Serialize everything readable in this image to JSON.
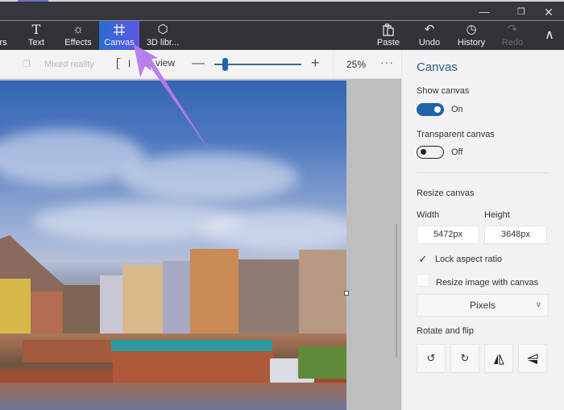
{
  "window": {
    "controls": {
      "minimize": "—",
      "restore": "❐",
      "close": "✕"
    }
  },
  "ribbon": {
    "left_items": [
      {
        "label": "ers",
        "icon": "stickers-icon"
      },
      {
        "label": "Text",
        "icon": "text-icon",
        "glyph": "T"
      },
      {
        "label": "Effects",
        "icon": "effects-icon",
        "glyph": "☼"
      },
      {
        "label": "Canvas",
        "icon": "canvas-icon",
        "glyph": "⌗",
        "active": true
      },
      {
        "label": "3D libr...",
        "icon": "3d-library-icon",
        "glyph": "⬡"
      }
    ],
    "right_items": [
      {
        "label": "Paste",
        "icon": "paste-icon",
        "glyph": "📋"
      },
      {
        "label": "Undo",
        "icon": "undo-icon",
        "glyph": "↶"
      },
      {
        "label": "History",
        "icon": "history-icon",
        "glyph": "◷"
      },
      {
        "label": "Redo",
        "icon": "redo-icon",
        "glyph": "↷",
        "disabled": true
      }
    ],
    "collapse_glyph": "∧",
    "active_color": "#2d6bd1"
  },
  "toolbar": {
    "mixed_reality": "Mixed reality",
    "mixed_reality_glyph": "❐",
    "view_3d": "3D view",
    "zoom_minus": "—",
    "zoom_plus": "+",
    "zoom_value": "25%",
    "zoom_fraction": 0.1,
    "more": "···"
  },
  "panel": {
    "title": "Canvas",
    "show_canvas": {
      "label": "Show canvas",
      "state": "On",
      "on": true
    },
    "transparent_canvas": {
      "label": "Transparent canvas",
      "state": "Off",
      "on": false
    },
    "resize_canvas": "Resize canvas",
    "width_label": "Width",
    "height_label": "Height",
    "width_value": "5472px",
    "height_value": "3648px",
    "lock_aspect": {
      "label": "Lock aspect ratio",
      "checked": true,
      "glyph": "✓"
    },
    "resize_image": {
      "label": "Resize image with canvas",
      "checked": false
    },
    "units": {
      "selected": "Pixels",
      "chevron": "∨"
    },
    "rotate_flip": "Rotate and flip",
    "rotate_buttons": [
      {
        "name": "rotate-left",
        "glyph": "↺"
      },
      {
        "name": "rotate-right",
        "glyph": "↻"
      },
      {
        "name": "flip-horizontal",
        "glyph": "◭"
      },
      {
        "name": "flip-vertical",
        "glyph": "◁"
      }
    ],
    "accent_color": "#1f64a8",
    "title_color": "#2c5d7d"
  },
  "annotation": {
    "arrow_color": "#b57bea"
  }
}
